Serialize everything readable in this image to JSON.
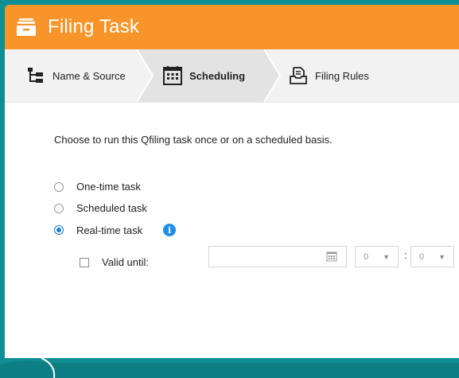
{
  "dialog": {
    "title": "Filing Task",
    "title_icon": "archive-box-icon"
  },
  "steps": [
    {
      "label": "Name & Source",
      "icon": "tree-structure-icon",
      "active": false
    },
    {
      "label": "Scheduling",
      "icon": "calendar-icon",
      "active": true
    },
    {
      "label": "Filing Rules",
      "icon": "file-box-icon",
      "active": false
    }
  ],
  "content": {
    "instruction": "Choose to run this Qfiling task once or on a scheduled basis.",
    "options": [
      {
        "label": "One-time task",
        "selected": false
      },
      {
        "label": "Scheduled task",
        "selected": false
      },
      {
        "label": "Real-time task",
        "selected": true
      }
    ],
    "valid_until": {
      "label": "Valid until:",
      "checked": false,
      "date_value": "",
      "hour_value": "0",
      "minute_value": "0"
    }
  },
  "colors": {
    "title_bar": "#f7952a",
    "accent_blue": "#1a7ad9",
    "background_teal": "#0f8f94"
  }
}
